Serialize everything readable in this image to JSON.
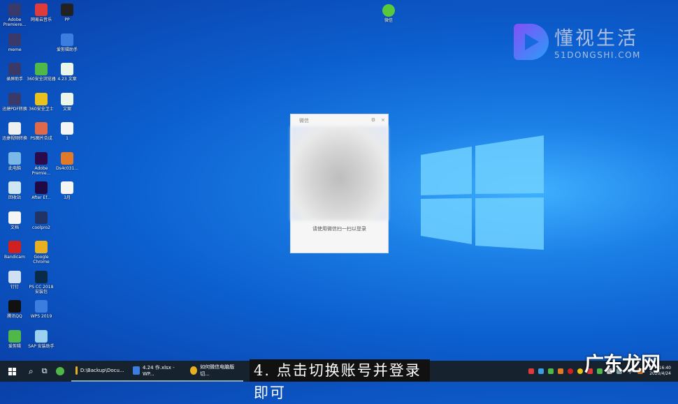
{
  "desktop_icons": [
    {
      "label": "Adobe Premiere...",
      "col": 0,
      "row": 0,
      "color": "#3a3a6a"
    },
    {
      "label": "网易云音乐",
      "col": 1,
      "row": 0,
      "color": "#e03a3a"
    },
    {
      "label": "PP",
      "col": 2,
      "row": 0,
      "color": "#222"
    },
    {
      "label": "meme",
      "col": 0,
      "row": 1,
      "color": "#3a3a6a"
    },
    {
      "label": "爱剪辑助手",
      "col": 2,
      "row": 1,
      "color": "#3c7de0"
    },
    {
      "label": "录屏助手",
      "col": 0,
      "row": 2,
      "color": "#3a3a6a"
    },
    {
      "label": "360安全浏览器",
      "col": 1,
      "row": 2,
      "color": "#4fb848"
    },
    {
      "label": "4.23 文案",
      "col": 2,
      "row": 2,
      "color": "#eaf6ea"
    },
    {
      "label": "迅捷PDF转换",
      "col": 0,
      "row": 3,
      "color": "#3a3a6a"
    },
    {
      "label": "360安全卫士",
      "col": 1,
      "row": 3,
      "color": "#e8c21a"
    },
    {
      "label": "文案",
      "col": 2,
      "row": 3,
      "color": "#eaf6ea"
    },
    {
      "label": "迅捷视频转换",
      "col": 0,
      "row": 4,
      "color": "#f0f0f0"
    },
    {
      "label": "PS图片合成",
      "col": 1,
      "row": 4,
      "color": "#e0694a"
    },
    {
      "label": "1",
      "col": 2,
      "row": 4,
      "color": "#f5f5f5"
    },
    {
      "label": "此电脑",
      "col": 0,
      "row": 5,
      "color": "#7ab8e8"
    },
    {
      "label": "Adobe Premie...",
      "col": 1,
      "row": 5,
      "color": "#2a0a4a"
    },
    {
      "label": "Ds4c031...",
      "col": 2,
      "row": 5,
      "color": "#e07a2a"
    },
    {
      "label": "回收站",
      "col": 0,
      "row": 6,
      "color": "#cfe6f5"
    },
    {
      "label": "After Ef...",
      "col": 1,
      "row": 6,
      "color": "#1f0a45"
    },
    {
      "label": "3月",
      "col": 2,
      "row": 6,
      "color": "#f5f5f5"
    },
    {
      "label": "文档",
      "col": 0,
      "row": 7,
      "color": "#f5f5f5"
    },
    {
      "label": "coolpro2",
      "col": 1,
      "row": 7,
      "color": "#223366"
    },
    {
      "label": "Bandicam",
      "col": 0,
      "row": 8,
      "color": "#d02020"
    },
    {
      "label": "Google Chrome",
      "col": 1,
      "row": 8,
      "color": "#e8b020"
    },
    {
      "label": "钉钉",
      "col": 0,
      "row": 9,
      "color": "#cfe0f5"
    },
    {
      "label": "PS CC 2018 安装包",
      "col": 1,
      "row": 9,
      "color": "#0a2a4a"
    },
    {
      "label": "腾讯QQ",
      "col": 0,
      "row": 10,
      "color": "#111"
    },
    {
      "label": "WPS 2019",
      "col": 1,
      "row": 10,
      "color": "#3c7de0"
    },
    {
      "label": "爱剪辑",
      "col": 0,
      "row": 11,
      "color": "#4fb848"
    },
    {
      "label": "SAP 安装助手",
      "col": 1,
      "row": 11,
      "color": "#9ad0f0"
    }
  ],
  "wechat_icon": {
    "label": "微信",
    "color": "#5ac83c"
  },
  "logo": {
    "title": "懂视生活",
    "subtitle": "51DONGSHI.COM"
  },
  "dialog": {
    "title": "微信",
    "settings_icon": "⚙",
    "close_icon": "×",
    "tip": "请使用微信扫一扫以登录"
  },
  "taskbar": {
    "start_icon": "windows-icon",
    "search_icon": "⌕",
    "taskview_icon": "⧉",
    "apps": [
      {
        "label": "D:\\Backup\\Docu...",
        "color": "#e8b020"
      },
      {
        "label": "4.24 作.xlsx - WP...",
        "color": "#3c7de0"
      },
      {
        "label": "如何微信电脑版切...",
        "color": "#e8b020"
      }
    ],
    "ime": "中",
    "time": "16:40",
    "date": "2020/4/24"
  },
  "subtitle": "4. 点击切换账号并登录即可",
  "watermark": "广东龙网"
}
